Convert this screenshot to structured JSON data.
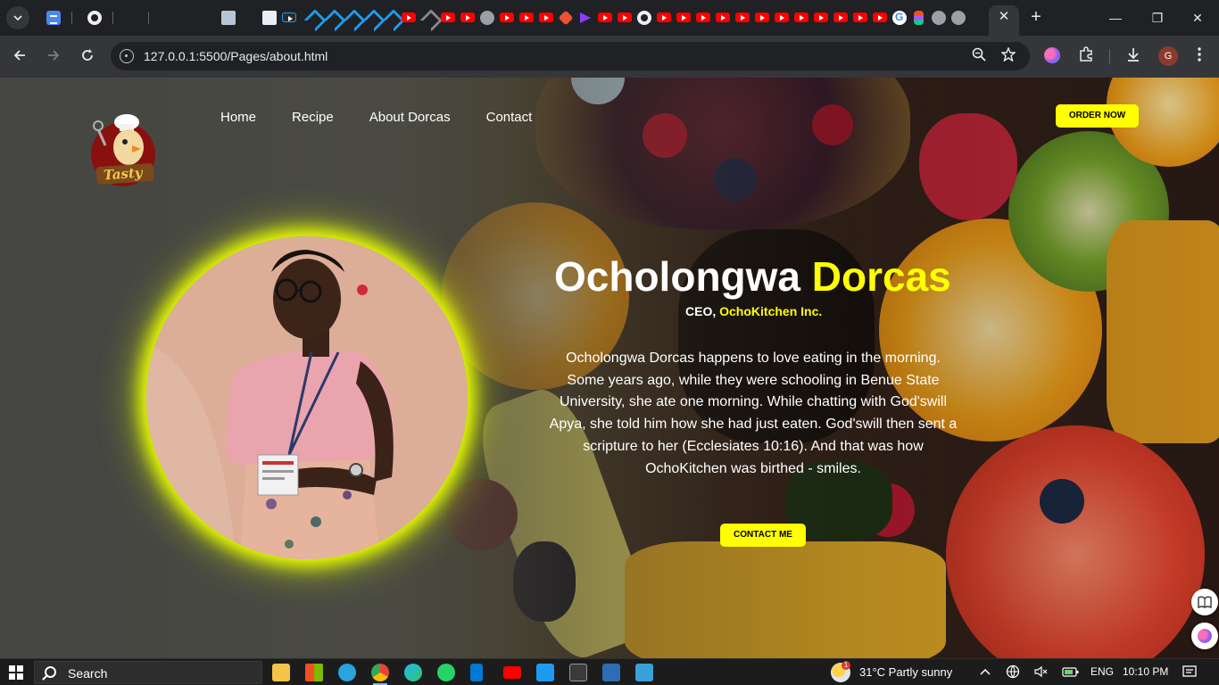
{
  "browser": {
    "url": "127.0.0.1:5500/Pages/about.html",
    "profile_initial": "G",
    "new_tab_label": "+",
    "close_tab_label": "✕",
    "window_controls": [
      "—",
      "❐",
      "✕"
    ]
  },
  "site": {
    "nav": [
      "Home",
      "Recipe",
      "About Dorcas",
      "Contact"
    ],
    "order_button": "ORDER NOW",
    "name_first": "Ocholongwa",
    "name_last": "Dorcas",
    "role_prefix": "CEO,",
    "role_company": "OchoKitchen Inc.",
    "bio": "Ocholongwa Dorcas happens to love eating in the morning. Some years ago, while they were schooling in Benue State University, she ate one morning. While chatting with God'swill Apya, she told him how she had just eaten. God'swill then sent a scripture to her (Ecclesiates 10:16). And that was how OchoKitchen was birthed - smiles.",
    "contact_button": "CONTACT ME",
    "logo_text": "Tasty",
    "accent_color": "#ffff00"
  },
  "taskbar": {
    "search_label": "Search",
    "weather_temp": "31°C",
    "weather_desc": "Partly sunny",
    "weather_badge": "1",
    "language": "ENG",
    "time": "10:10 PM"
  }
}
